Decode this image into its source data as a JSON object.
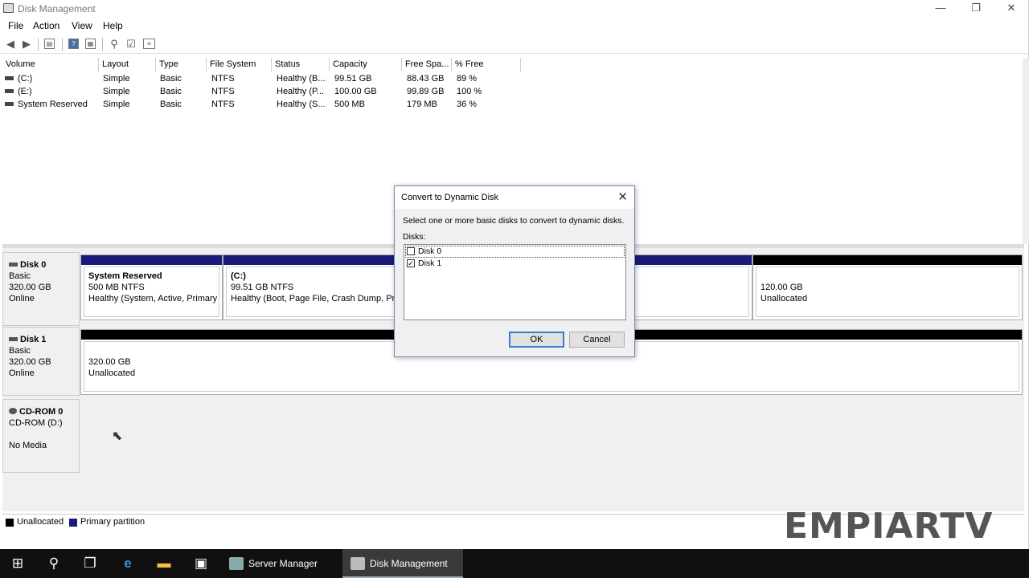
{
  "window": {
    "title": "Disk Management",
    "controls": [
      "—",
      "❐",
      "✕"
    ]
  },
  "menu": [
    "File",
    "Action",
    "View",
    "Help"
  ],
  "toolbar_icons": [
    "back-icon",
    "forward-icon",
    "properties-icon",
    "help-icon",
    "list-icon",
    "key-icon",
    "check-icon",
    "info-icon"
  ],
  "volumes": {
    "columns": [
      "Volume",
      "Layout",
      "Type",
      "File System",
      "Status",
      "Capacity",
      "Free Spa...",
      "% Free"
    ],
    "rows": [
      [
        "(C:)",
        "Simple",
        "Basic",
        "NTFS",
        "Healthy (B...",
        "99.51 GB",
        "88.43 GB",
        "89 %"
      ],
      [
        "(E:)",
        "Simple",
        "Basic",
        "NTFS",
        "Healthy (P...",
        "100.00 GB",
        "99.89 GB",
        "100 %"
      ],
      [
        "System Reserved",
        "Simple",
        "Basic",
        "NTFS",
        "Healthy (S...",
        "500 MB",
        "179 MB",
        "36 %"
      ]
    ]
  },
  "disks": {
    "disk0": {
      "name": "Disk 0",
      "type": "Basic",
      "size": "320.00 GB",
      "status": "Online",
      "partitions": [
        {
          "title": "System Reserved",
          "line1": "500 MB NTFS",
          "line2": "Healthy (System, Active, Primary"
        },
        {
          "title": "(C:)",
          "line1": "99.51 GB NTFS",
          "line2": "Healthy (Boot, Page File, Crash Dump, Pri"
        },
        {
          "title": "",
          "line1": "120.00 GB",
          "line2": "Unallocated"
        }
      ]
    },
    "disk1": {
      "name": "Disk 1",
      "type": "Basic",
      "size": "320.00 GB",
      "status": "Online",
      "partitions": [
        {
          "line1": "320.00 GB",
          "line2": "Unallocated"
        }
      ]
    },
    "cdrom0": {
      "name": "CD-ROM 0",
      "drive": "CD-ROM (D:)",
      "status": "No Media"
    }
  },
  "legend": [
    {
      "label": "Unallocated",
      "color": "#000000"
    },
    {
      "label": "Primary partition",
      "color": "#1a1a7a"
    }
  ],
  "colors": {
    "primary": "#1a1a7a",
    "unallocated": "#000000"
  },
  "watermark": "EMPIARTV",
  "dialog": {
    "title": "Convert to Dynamic Disk",
    "prompt": "Select one or more basic disks to convert to dynamic disks.",
    "list_label": "Disks:",
    "disks": [
      {
        "label": "Disk 0",
        "checked": false
      },
      {
        "label": "Disk 1",
        "checked": true
      }
    ],
    "ok": "OK",
    "cancel": "Cancel"
  },
  "taskbar": {
    "apps": [
      {
        "label": "Server Manager"
      },
      {
        "label": "Disk Management"
      }
    ]
  }
}
